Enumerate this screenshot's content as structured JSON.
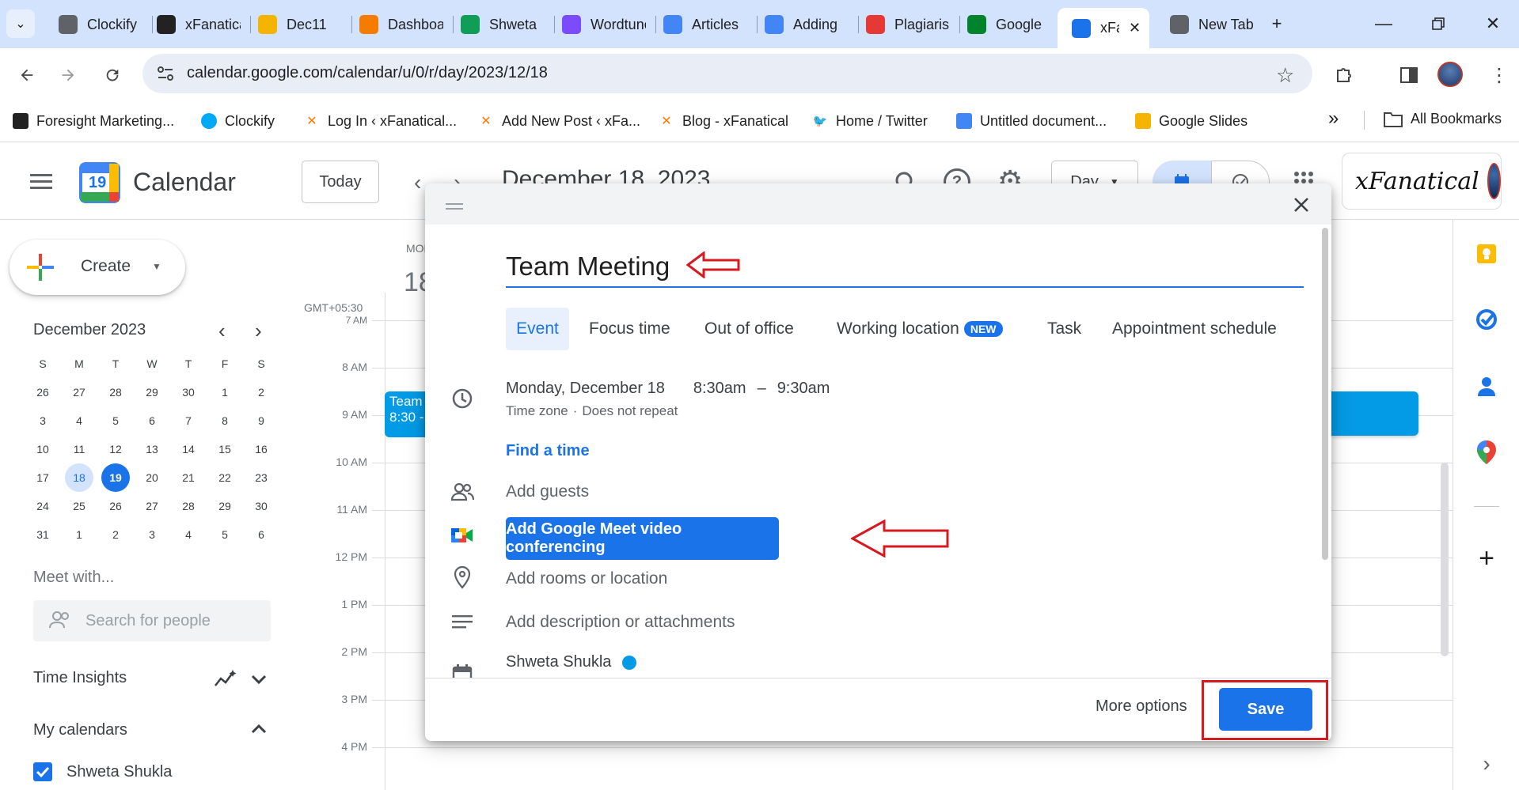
{
  "browser": {
    "tabs": [
      {
        "title": "Clockify",
        "icon": "clockify-icon",
        "color": "#5f6368"
      },
      {
        "title": "xFanatical",
        "icon": "xfanatical-icon",
        "color": "#222222"
      },
      {
        "title": "Dec11",
        "icon": "google-slides-icon",
        "color": "#f4b400"
      },
      {
        "title": "Dashboard",
        "icon": "wordpress-x-icon",
        "color": "#f57c00"
      },
      {
        "title": "Shweta",
        "icon": "google-sheets-icon",
        "color": "#0f9d58"
      },
      {
        "title": "Wordtune",
        "icon": "wordtune-icon",
        "color": "#7b4bff"
      },
      {
        "title": "Articles",
        "icon": "google-drive-icon",
        "color": "#4285f4"
      },
      {
        "title": "Adding",
        "icon": "google-docs-icon",
        "color": "#4285f4"
      },
      {
        "title": "Plagiarism",
        "icon": "sst-icon",
        "color": "#e53935"
      },
      {
        "title": "Google",
        "icon": "google-meet-icon",
        "color": "#00832d"
      },
      {
        "title": "xFanatical",
        "icon": "google-calendar-icon",
        "color": "#1a73e8"
      },
      {
        "title": "New Tab",
        "icon": "chrome-icon",
        "color": "#5f6368"
      }
    ],
    "url": "calendar.google.com/calendar/u/0/r/day/2023/12/18",
    "bookmarks": [
      {
        "label": "Foresight Marketing...",
        "icon": "foresight-icon",
        "color": "#222222"
      },
      {
        "label": "Clockify",
        "icon": "clockify-icon",
        "color": "#03a9f4"
      },
      {
        "label": "Log In ‹ xFanatical...",
        "icon": "x-icon",
        "color": "#f57c00"
      },
      {
        "label": "Add New Post ‹ xFa...",
        "icon": "x-icon",
        "color": "#f57c00"
      },
      {
        "label": "Blog - xFanatical",
        "icon": "x-icon",
        "color": "#f57c00"
      },
      {
        "label": "Home / Twitter",
        "icon": "twitter-icon",
        "color": "#1d9bf0"
      },
      {
        "label": "Untitled document...",
        "icon": "google-docs-icon",
        "color": "#4285f4"
      },
      {
        "label": "Google Slides",
        "icon": "google-slides-icon",
        "color": "#f4b400"
      }
    ],
    "more_bookmarks": "»",
    "all_bookmarks": "All Bookmarks"
  },
  "calendar": {
    "app_title": "Calendar",
    "logo_day": "19",
    "today_label": "Today",
    "date_heading": "December 18, 2023",
    "view_label": "Day",
    "brand_logo_text": "xFanatical",
    "create_label": "Create",
    "mini_month": "December 2023",
    "weekday_heads": [
      "S",
      "M",
      "T",
      "W",
      "T",
      "F",
      "S"
    ],
    "mini_weeks": [
      [
        "26",
        "27",
        "28",
        "29",
        "30",
        "1",
        "2"
      ],
      [
        "3",
        "4",
        "5",
        "6",
        "7",
        "8",
        "9"
      ],
      [
        "10",
        "11",
        "12",
        "13",
        "14",
        "15",
        "16"
      ],
      [
        "17",
        "18",
        "19",
        "20",
        "21",
        "22",
        "23"
      ],
      [
        "24",
        "25",
        "26",
        "27",
        "28",
        "29",
        "30"
      ],
      [
        "31",
        "1",
        "2",
        "3",
        "4",
        "5",
        "6"
      ]
    ],
    "meet_with": "Meet with...",
    "search_people": "Search for people",
    "time_insights": "Time Insights",
    "my_calendars": "My calendars",
    "my_calendar_name": "Shweta Shukla",
    "day_col_label": "MON",
    "day_col_num": "18",
    "timezone": "GMT+05:30",
    "hours": [
      "7 AM",
      "8 AM",
      "9 AM",
      "10 AM",
      "11 AM",
      "12 PM",
      "1 PM",
      "2 PM",
      "3 PM",
      "4 PM"
    ],
    "event_chip_title": "Team",
    "event_chip_time": "8:30 -"
  },
  "dialog": {
    "title_value": "Team Meeting",
    "type_tabs": [
      "Event",
      "Focus time",
      "Out of office",
      "Working location",
      "Task",
      "Appointment schedule"
    ],
    "new_badge": "NEW",
    "date": "Monday, December 18",
    "start_time": "8:30am",
    "dash": "–",
    "end_time": "9:30am",
    "timezone_link": "Time zone",
    "separator": "·",
    "repeat": "Does not repeat",
    "find_time": "Find a time",
    "add_guests": "Add guests",
    "meet_button": "Add Google Meet video conferencing",
    "add_location": "Add rooms or location",
    "add_description": "Add description or attachments",
    "calendar_owner": "Shweta Shukla",
    "more_options": "More options",
    "save": "Save"
  },
  "colors": {
    "accent": "#1a73e8",
    "annotation": "#d71920",
    "event_blue": "#039be5"
  }
}
